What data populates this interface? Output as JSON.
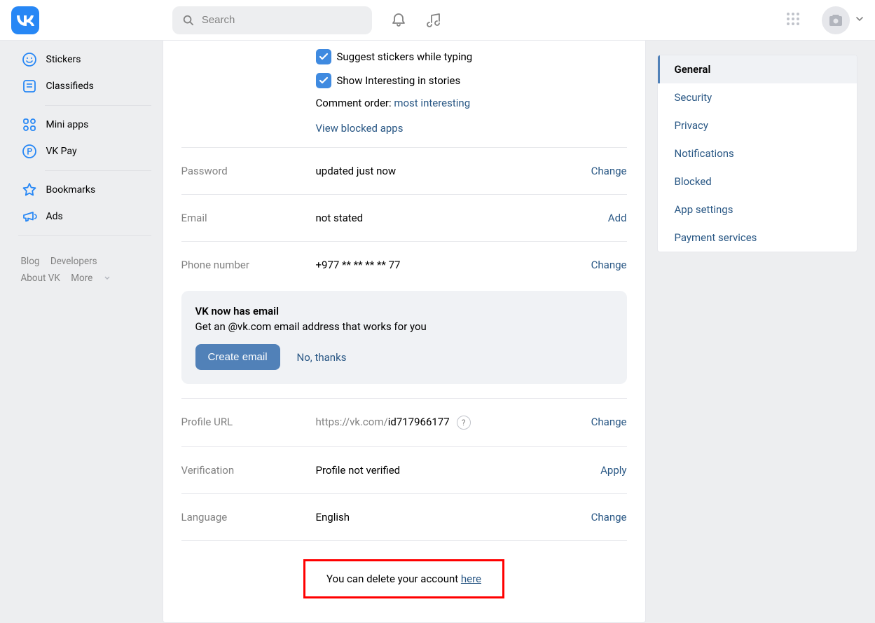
{
  "header": {
    "search_placeholder": "Search"
  },
  "left_nav": {
    "stickers": "Stickers",
    "classifieds": "Classifieds",
    "mini_apps": "Mini apps",
    "vk_pay": "VK Pay",
    "bookmarks": "Bookmarks",
    "ads": "Ads"
  },
  "footer": {
    "blog": "Blog",
    "developers": "Developers",
    "about": "About VK",
    "more": "More"
  },
  "options": {
    "suggest_stickers": "Suggest stickers while typing",
    "show_interesting": "Show Interesting in stories",
    "comment_order_label": "Comment order: ",
    "comment_order_value": "most interesting",
    "view_blocked": "View blocked apps"
  },
  "settings": {
    "password": {
      "label": "Password",
      "value": "updated just now",
      "action": "Change"
    },
    "email": {
      "label": "Email",
      "value": "not stated",
      "action": "Add"
    },
    "phone": {
      "label": "Phone number",
      "value": "+977 ** ** ** ** 77",
      "action": "Change"
    },
    "profile_url": {
      "label": "Profile URL",
      "prefix": "https://vk.com/",
      "id": "id717966177",
      "action": "Change"
    },
    "verification": {
      "label": "Verification",
      "value": "Profile not verified",
      "action": "Apply"
    },
    "language": {
      "label": "Language",
      "value": "English",
      "action": "Change"
    }
  },
  "promo": {
    "title": "VK now has email",
    "subtitle": "Get an @vk.com email address that works for you",
    "create": "Create email",
    "dismiss": "No, thanks"
  },
  "delete": {
    "text": "You can delete your account ",
    "link": "here"
  },
  "right_nav": {
    "general": "General",
    "security": "Security",
    "privacy": "Privacy",
    "notifications": "Notifications",
    "blocked": "Blocked",
    "app_settings": "App settings",
    "payment_services": "Payment services"
  }
}
